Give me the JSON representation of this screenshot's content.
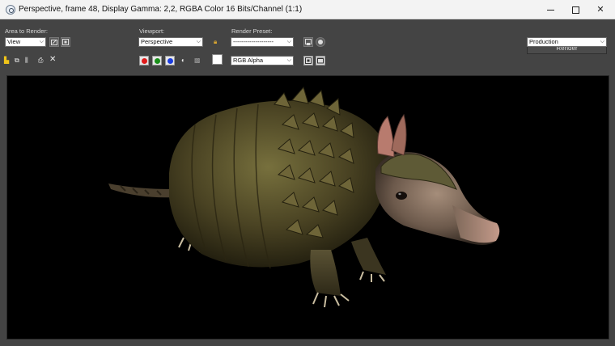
{
  "window": {
    "title": "Perspective, frame 48, Display Gamma: 2,2, RGBA Color 16 Bits/Channel (1:1)",
    "minimize_label": "",
    "maximize_label": "",
    "close_label": "✕"
  },
  "toolbar": {
    "area_to_render_label": "Area to Render:",
    "area_to_render_value": "View",
    "viewport_label": "Viewport:",
    "viewport_value": "Perspective",
    "render_preset_label": "Render Preset:",
    "render_preset_value": "--------------------",
    "render_button_label": "Render",
    "render_mode_value": "Production",
    "channel_value": "RGB Alpha"
  },
  "channels": {
    "red_color": "#e01b1b",
    "green_color": "#1a8f1a",
    "blue_color": "#1b3de0"
  },
  "icons": [
    "app-icon",
    "edit-region-icon",
    "auto-region-icon",
    "lock-icon",
    "render-setup-icon",
    "environment-icon",
    "save-image-icon",
    "copy-image-icon",
    "clone-window-icon",
    "print-icon",
    "clear-icon",
    "display-alpha-icon",
    "monochrome-icon",
    "color-swatch",
    "frame-icon",
    "window-icon"
  ],
  "viewport": {
    "background_color": "#000000",
    "subject": "armadillo"
  }
}
